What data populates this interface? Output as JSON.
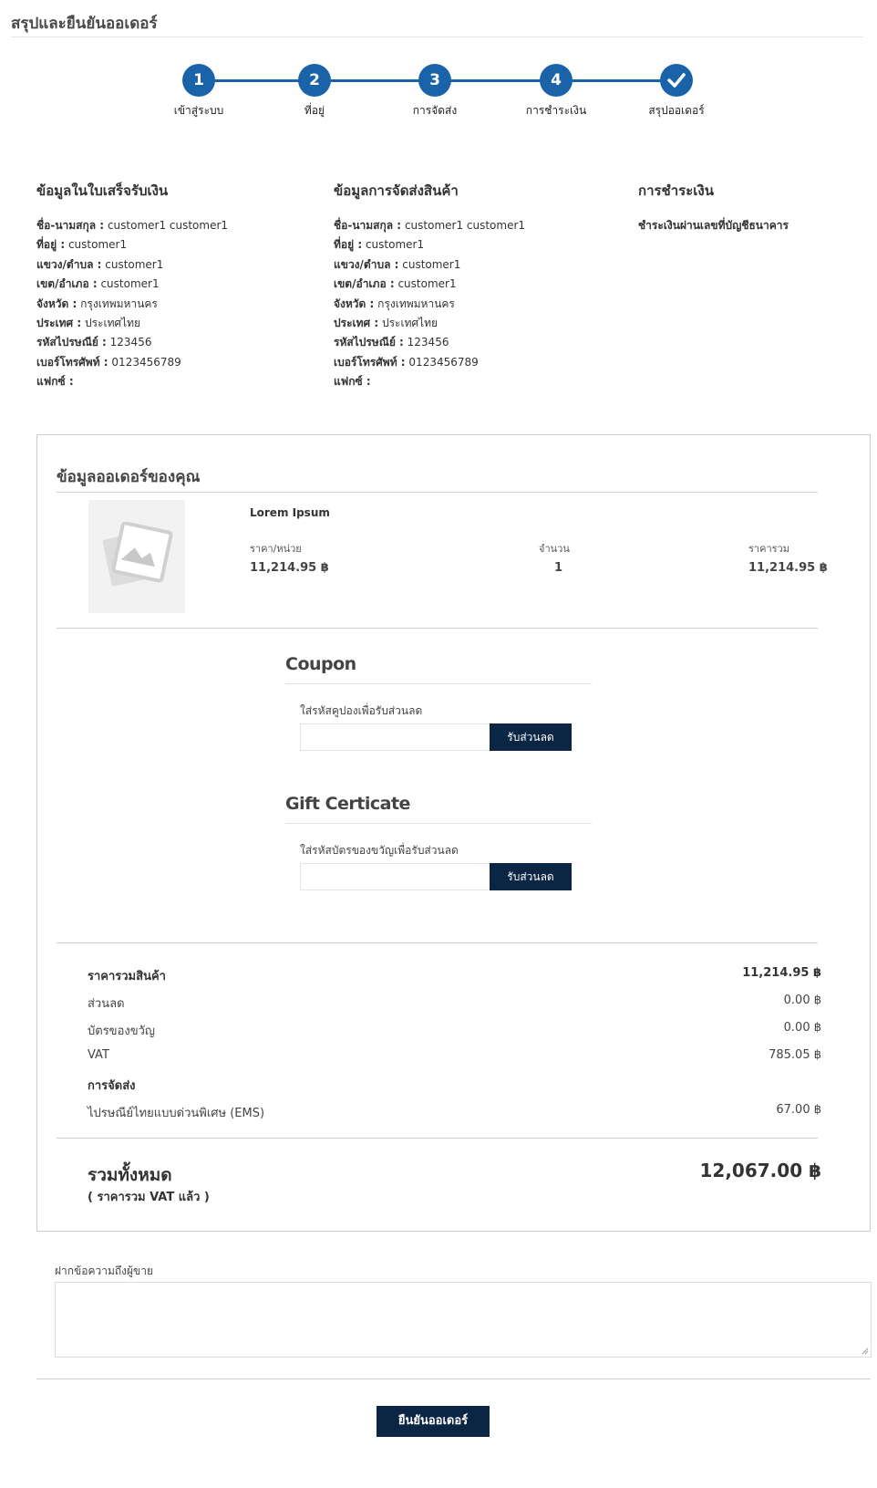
{
  "page": {
    "title": "สรุปและยืนยันออเดอร์"
  },
  "steps": [
    {
      "number": "1",
      "label": "เข้าสู่ระบบ"
    },
    {
      "number": "2",
      "label": "ที่อยู่"
    },
    {
      "number": "3",
      "label": "การจัดส่ง"
    },
    {
      "number": "4",
      "label": "การชำระเงิน"
    },
    {
      "number": "",
      "icon": "check-icon",
      "label": "สรุปออเดอร์"
    }
  ],
  "billing": {
    "heading": "ข้อมูลในใบเสร็จรับเงิน",
    "rows": [
      {
        "label": "ชื่อ-นามสกุล :",
        "value": "customer1 customer1"
      },
      {
        "label": "ที่อยู่ :",
        "value": "customer1"
      },
      {
        "label": "แขวง/ตำบล :",
        "value": "customer1"
      },
      {
        "label": "เขต/อำเภอ :",
        "value": "customer1"
      },
      {
        "label": "จังหวัด :",
        "value": "กรุงเทพมหานคร"
      },
      {
        "label": "ประเทศ :",
        "value": "ประเทศไทย"
      },
      {
        "label": "รหัสไปรษณีย์ :",
        "value": "123456"
      },
      {
        "label": "เบอร์โทรศัพท์ :",
        "value": "0123456789"
      },
      {
        "label": "แฟกซ์ :",
        "value": ""
      }
    ]
  },
  "shipping": {
    "heading": "ข้อมูลการจัดส่งสินค้า",
    "rows": [
      {
        "label": "ชื่อ-นามสกุล :",
        "value": "customer1 customer1"
      },
      {
        "label": "ที่อยู่ :",
        "value": "customer1"
      },
      {
        "label": "แขวง/ตำบล :",
        "value": "customer1"
      },
      {
        "label": "เขต/อำเภอ :",
        "value": "customer1"
      },
      {
        "label": "จังหวัด :",
        "value": "กรุงเทพมหานคร"
      },
      {
        "label": "ประเทศ :",
        "value": "ประเทศไทย"
      },
      {
        "label": "รหัสไปรษณีย์ :",
        "value": "123456"
      },
      {
        "label": "เบอร์โทรศัพท์ :",
        "value": "0123456789"
      },
      {
        "label": "แฟกซ์ :",
        "value": ""
      }
    ]
  },
  "payment": {
    "heading": "การชำระเงิน",
    "method": "ชำระเงินผ่านเลขที่บัญชีธนาคาร"
  },
  "order": {
    "heading": "ข้อมูลออเดอร์ของคุณ",
    "item": {
      "name": "Lorem Ipsum",
      "image_icon": "image-placeholder-icon",
      "unit_price_label": "ราคา/หน่วย",
      "unit_price": "11,214.95 ฿",
      "qty_label": "จำนวน",
      "qty": "1",
      "total_label": "ราคารวม",
      "total": "11,214.95 ฿"
    },
    "coupon": {
      "title": "Coupon",
      "label": "ใส่รหัสคูปองเพื่อรับส่วนลด",
      "value": "",
      "button": "รับส่วนลด"
    },
    "gift": {
      "title": "Gift Certicate",
      "label": "ใส่รหัสบัตรของขวัญเพื่อรับส่วนลด",
      "value": "",
      "button": "รับส่วนลด"
    },
    "summary": {
      "subtotal_label": "ราคารวมสินค้า",
      "subtotal": "11,214.95 ฿",
      "discount_label": "ส่วนลด",
      "discount": "0.00 ฿",
      "gift_label": "บัตรของขวัญ",
      "gift": "0.00 ฿",
      "vat_label": "VAT",
      "vat": "785.05 ฿",
      "shipping_label": "การจัดส่ง",
      "shipping_method": "ไปรษณีย์ไทยแบบด่วนพิเศษ (EMS)",
      "shipping_cost": "67.00 ฿"
    },
    "grand_total_label": "รวมทั้งหมด",
    "grand_total_note": "( ราคารวม VAT แล้ว )",
    "grand_total": "12,067.00 ฿"
  },
  "message": {
    "label": "ฝากข้อความถึงผู้ขาย",
    "value": ""
  },
  "confirm_button": "ยืนยันออเดอร์",
  "colors": {
    "accent": "#1b63a9",
    "button": "#0b2545"
  }
}
